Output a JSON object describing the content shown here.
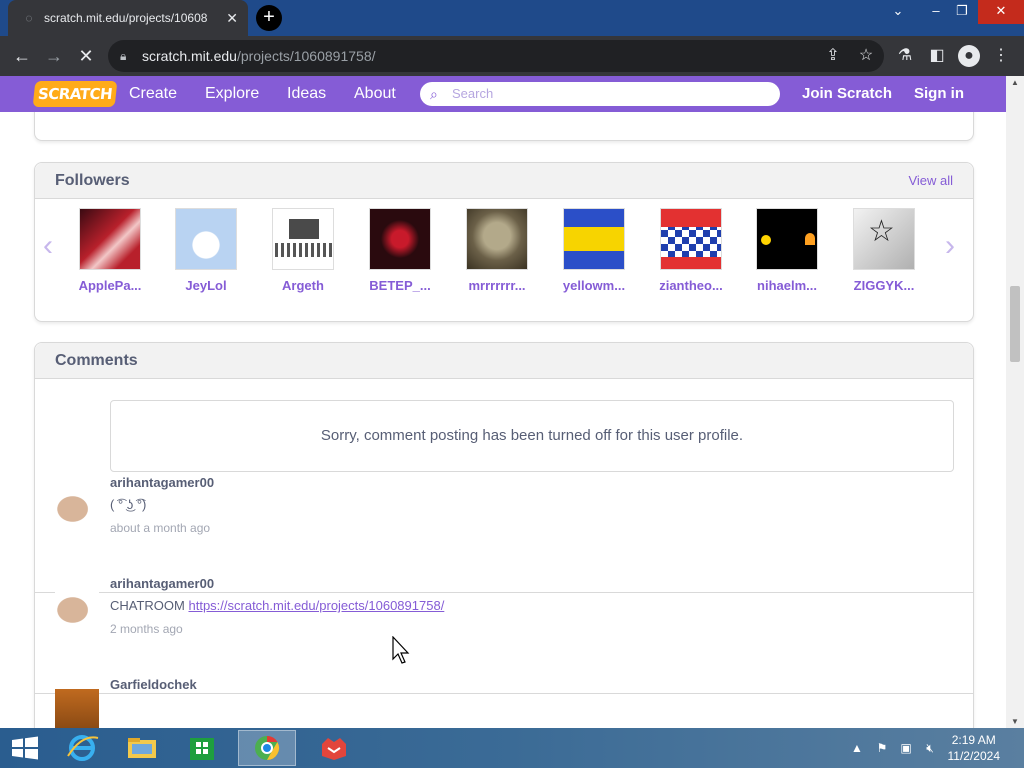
{
  "browser": {
    "tab_title": "scratch.mit.edu/projects/10608",
    "url_domain": "scratch.mit.edu",
    "url_path": "/projects/1060891758/"
  },
  "header": {
    "logo_text": "SCRATCH",
    "nav": [
      "Create",
      "Explore",
      "Ideas",
      "About"
    ],
    "search_placeholder": "Search",
    "join_label": "Join Scratch",
    "signin_label": "Sign in"
  },
  "followers": {
    "title": "Followers",
    "view_all": "View all",
    "items": [
      {
        "name": "ApplePa...",
        "color": "#b8202b"
      },
      {
        "name": "JeyLol",
        "color": "#b9d3f2"
      },
      {
        "name": "Argeth",
        "color": "#ffffff"
      },
      {
        "name": "BETEP_...",
        "color": "#2a0a0e"
      },
      {
        "name": "mrrrrrrr...",
        "color": "#8a7a60"
      },
      {
        "name": "yellowm...",
        "color": "#2b4fc8"
      },
      {
        "name": "ziantheo...",
        "color": "#e33131"
      },
      {
        "name": "nihaelm...",
        "color": "#000000"
      },
      {
        "name": "ZIGGYK...",
        "color": "#d9d9d9"
      }
    ]
  },
  "comments": {
    "title": "Comments",
    "notice": "Sorry, comment posting has been turned off for this user profile.",
    "items": [
      {
        "user": "arihantagamer00",
        "text": "( ͡° ͜ʖ ͡°)",
        "link": "",
        "time": "about a month ago"
      },
      {
        "user": "arihantagamer00",
        "text": "CHATROOM ",
        "link": "https://scratch.mit.edu/projects/1060891758/",
        "time": "2 months ago"
      },
      {
        "user": "Garfieldochek",
        "text": "",
        "link": "",
        "time": ""
      }
    ]
  },
  "taskbar": {
    "time": "2:19 AM",
    "date": "11/2/2024"
  },
  "colors": {
    "scratch_purple": "#855cd6",
    "scratch_orange": "#ffab19",
    "browser_dark": "#35363a",
    "taskbar_blue": "#2a5d8f"
  }
}
